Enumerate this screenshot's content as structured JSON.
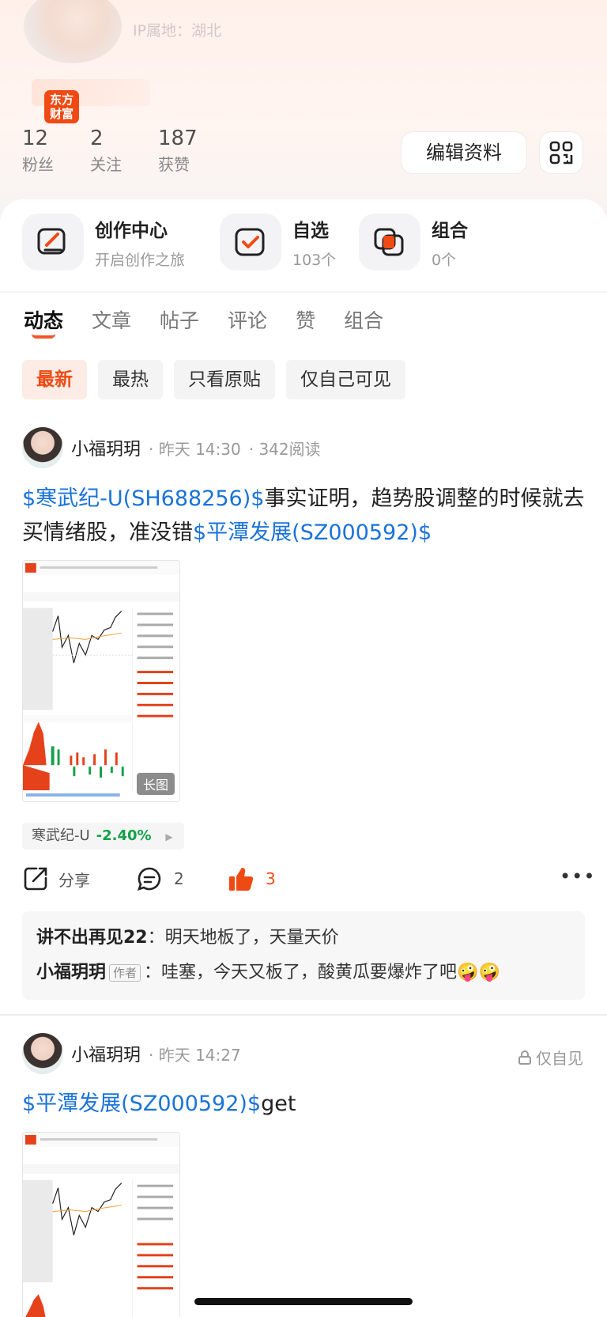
{
  "profile": {
    "ip_location": "IP属地：湖北",
    "badge": "东方\n财富",
    "stats": [
      {
        "num": "12",
        "label": "粉丝"
      },
      {
        "num": "2",
        "label": "关注"
      },
      {
        "num": "187",
        "label": "获赞"
      }
    ],
    "edit_button": "编辑资料"
  },
  "entries": [
    {
      "title": "创作中心",
      "sub": "开启创作之旅"
    },
    {
      "title": "自选",
      "sub": "103个"
    },
    {
      "title": "组合",
      "sub": "0个"
    }
  ],
  "tabs": [
    "动态",
    "文章",
    "帖子",
    "评论",
    "赞",
    "组合"
  ],
  "filters": [
    "最新",
    "最热",
    "只看原贴",
    "仅自己可见"
  ],
  "post1": {
    "user": "小福玥玥",
    "time": "· 昨天 14:30",
    "reads": "· 342阅读",
    "stock1": "$寒武纪-U(SH688256)$",
    "text1": "事实证明，趋势股调整的时候就去买情绪股，准没错",
    "stock2": "$平潭发展(SZ000592)$",
    "long_image_tag": "长图",
    "stock_chip_name": "寒武纪-U",
    "stock_chip_pct": "-2.40%",
    "share": "分享",
    "comment_count": "2",
    "like_count": "3",
    "comments": [
      {
        "user": "讲不出再见22",
        "text": "明天地板了，天量天价"
      },
      {
        "user": "小福玥玥",
        "tag": "作者",
        "text": "哇塞，今天又板了，酸黄瓜要爆炸了吧🤪🤪"
      }
    ]
  },
  "post2": {
    "user": "小福玥玥",
    "time": "· 昨天 14:27",
    "visibility": "仅自见",
    "stock": "$平潭发展(SZ000592)$",
    "text": "get"
  },
  "colors": {
    "accent": "#ef4a14",
    "stock_link": "#1a73d9",
    "down_green": "#16a04a"
  }
}
